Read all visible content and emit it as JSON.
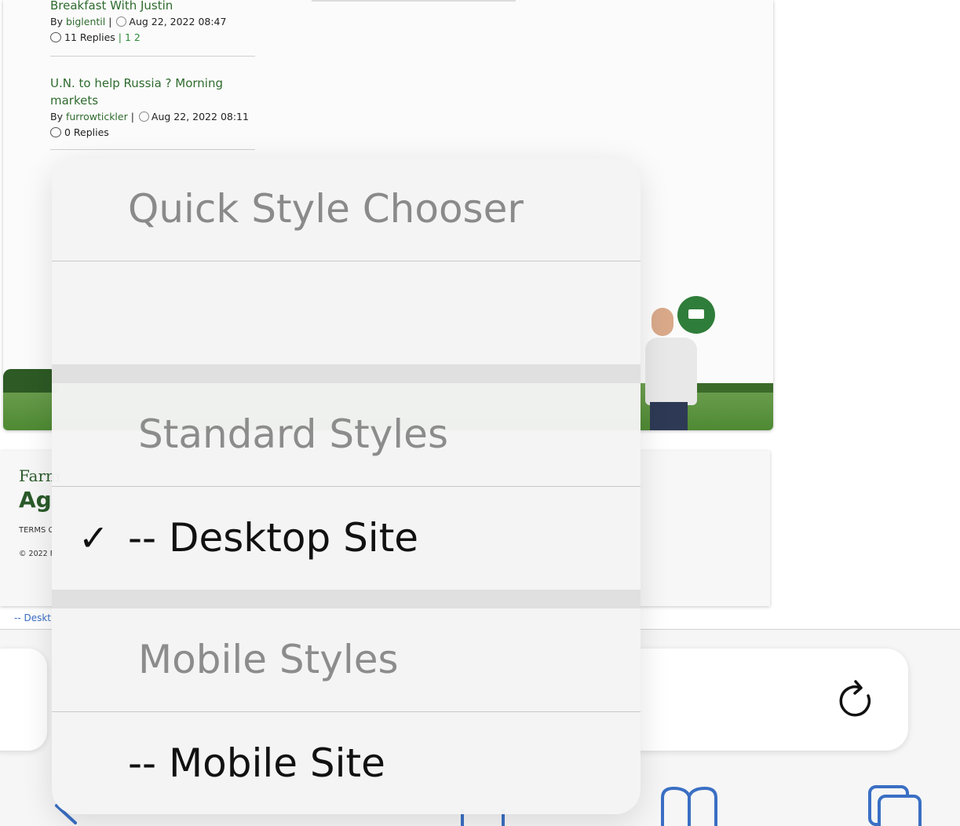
{
  "background": {
    "threads": [
      {
        "title": "Breakfast With Justin",
        "by": "By",
        "user": "biglentil",
        "date": "Aug 22, 2022 08:47",
        "replies": "11 Replies",
        "pages": "1 2"
      },
      {
        "title": "U.N. to help Russia ? Morning markets",
        "by": "By",
        "user": "furrowtickler",
        "date": "Aug 22, 2022 08:11",
        "replies": "0 Replies",
        "pages": ""
      }
    ],
    "footer": {
      "logo_line1": "Farm",
      "logo_line2": "Ag",
      "terms": "TERMS C",
      "copyright": "© 2022 F"
    },
    "desktop_link": "-- Deskt"
  },
  "popover": {
    "title": "Quick Style Chooser",
    "sections": [
      {
        "heading": "Standard Styles",
        "options": [
          {
            "label": "-- Desktop Site",
            "checked": true,
            "check_mark": "✓"
          }
        ]
      },
      {
        "heading": "Mobile Styles",
        "options": [
          {
            "label": "-- Mobile Site",
            "checked": false
          }
        ]
      }
    ]
  },
  "toolbar": {
    "icons": [
      "reload-icon",
      "back-icon",
      "share-icon",
      "bookmarks-icon",
      "tabs-icon"
    ],
    "accent_color": "#3a6fc4"
  }
}
